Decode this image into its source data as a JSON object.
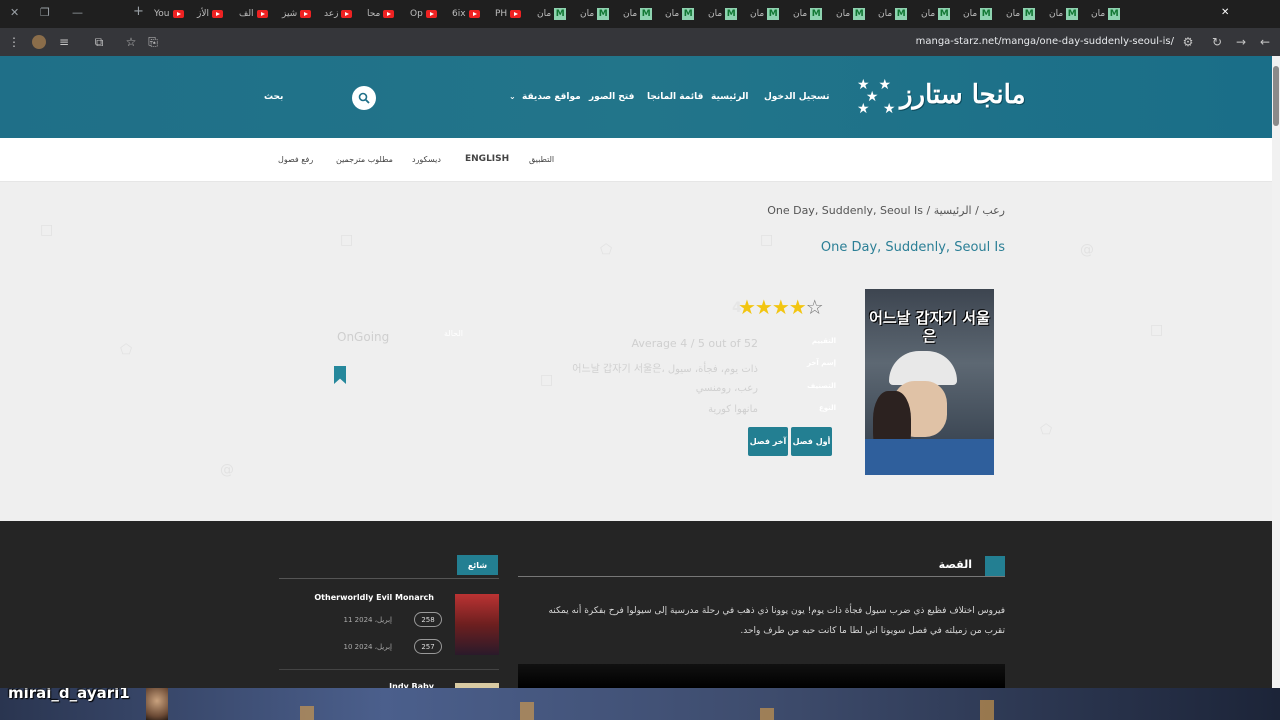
{
  "browser": {
    "tabs": [
      {
        "label": "You",
        "icon": "youtube-icon"
      },
      {
        "label": "الأز",
        "icon": "youtube-icon"
      },
      {
        "label": "الف",
        "icon": "youtube-icon"
      },
      {
        "label": "شيز",
        "icon": "youtube-icon"
      },
      {
        "label": "زعد",
        "icon": "youtube-icon"
      },
      {
        "label": "محا",
        "icon": "youtube-icon"
      },
      {
        "label": "Op",
        "icon": "youtube-icon"
      },
      {
        "label": "6ix",
        "icon": "youtube-icon"
      },
      {
        "label": "PH",
        "icon": "youtube-icon"
      },
      {
        "label": "مان",
        "icon": "manga-starz-icon"
      },
      {
        "label": "مان",
        "icon": "manga-starz-icon"
      },
      {
        "label": "مان",
        "icon": "manga-starz-icon"
      },
      {
        "label": "مان",
        "icon": "manga-starz-icon"
      },
      {
        "label": "مان",
        "icon": "manga-starz-icon"
      },
      {
        "label": "مان",
        "icon": "manga-starz-icon"
      },
      {
        "label": "مان",
        "icon": "manga-starz-icon"
      },
      {
        "label": "مان",
        "icon": "manga-starz-icon"
      },
      {
        "label": "مان",
        "icon": "manga-starz-icon"
      },
      {
        "label": "مان",
        "icon": "manga-starz-icon"
      },
      {
        "label": "مان",
        "icon": "manga-starz-icon"
      },
      {
        "label": "مان",
        "icon": "manga-starz-icon"
      },
      {
        "label": "مان",
        "icon": "manga-starz-icon"
      },
      {
        "label": "مان",
        "icon": "manga-starz-icon"
      }
    ],
    "url": "manga-starz.net/manga/one-day-suddenly-seoul-is/"
  },
  "header": {
    "logo_text": "مانجا ستارز",
    "nav": {
      "login": "تسجيل الدخول",
      "home": "الرئيسية",
      "manga_list": "قائمة المانجا",
      "image_opener": "فتح الصور",
      "friend_sites": "مواقع صديقة",
      "search": "بحث"
    }
  },
  "subnav": {
    "app": "التطبيق",
    "english": "ENGLISH",
    "discord": "ديسكورد",
    "translators": "مطلوب مترجمين",
    "upload": "رفع فصول"
  },
  "manga": {
    "breadcrumb_home": "الرئيسية",
    "breadcrumb_sep": " / ",
    "breadcrumb_genre": "رعب",
    "breadcrumb_title": "One Day, Suddenly, Seoul Is",
    "title": "One Day, Suddenly, Seoul Is",
    "cover_title": "어느날 갑자기 서울은",
    "rating": "4",
    "rating_stars": 4,
    "labels": {
      "rating": "التقييم",
      "alt_name": "إسم آخر",
      "genres": "التصنيف",
      "type": "النوع",
      "status": "الحالة"
    },
    "average": "Average 4 / 5 out of 52",
    "alt_name": "어느날 갑자기 서울은، ذات يوم، فجأة، سيول",
    "genres": "رعب، رومنسي",
    "type": "مانهوا كورية",
    "status": "OnGoing",
    "first_chapter": "أول فصل",
    "last_chapter": "آخر فصل"
  },
  "story": {
    "heading": "القصة",
    "text": "فيروس اختلاف فظيع ذي ضرب سيول فجأة ذات يوم! يون يوونا ذي ذهب في رحلة مدرسية إلى سيولوا فرح بفكرة أنه يمكنه تقرب من زميلته في فصل سويونا اني لطا ما كانت حبه من طرف واحد."
  },
  "trending": {
    "heading": "شائع",
    "items": [
      {
        "title": "Otherworldly Evil Monarch",
        "chapters": [
          {
            "num": "258",
            "date": "11 إبريل، 2024"
          },
          {
            "num": "257",
            "date": "10 إبريل، 2024"
          }
        ]
      },
      {
        "title": "Indy Baby"
      }
    ]
  },
  "stream": {
    "username": "mirai_d_ayari1"
  },
  "colors": {
    "header_teal": "#1f6f88",
    "accent": "#237f92",
    "star": "#f2c511"
  }
}
